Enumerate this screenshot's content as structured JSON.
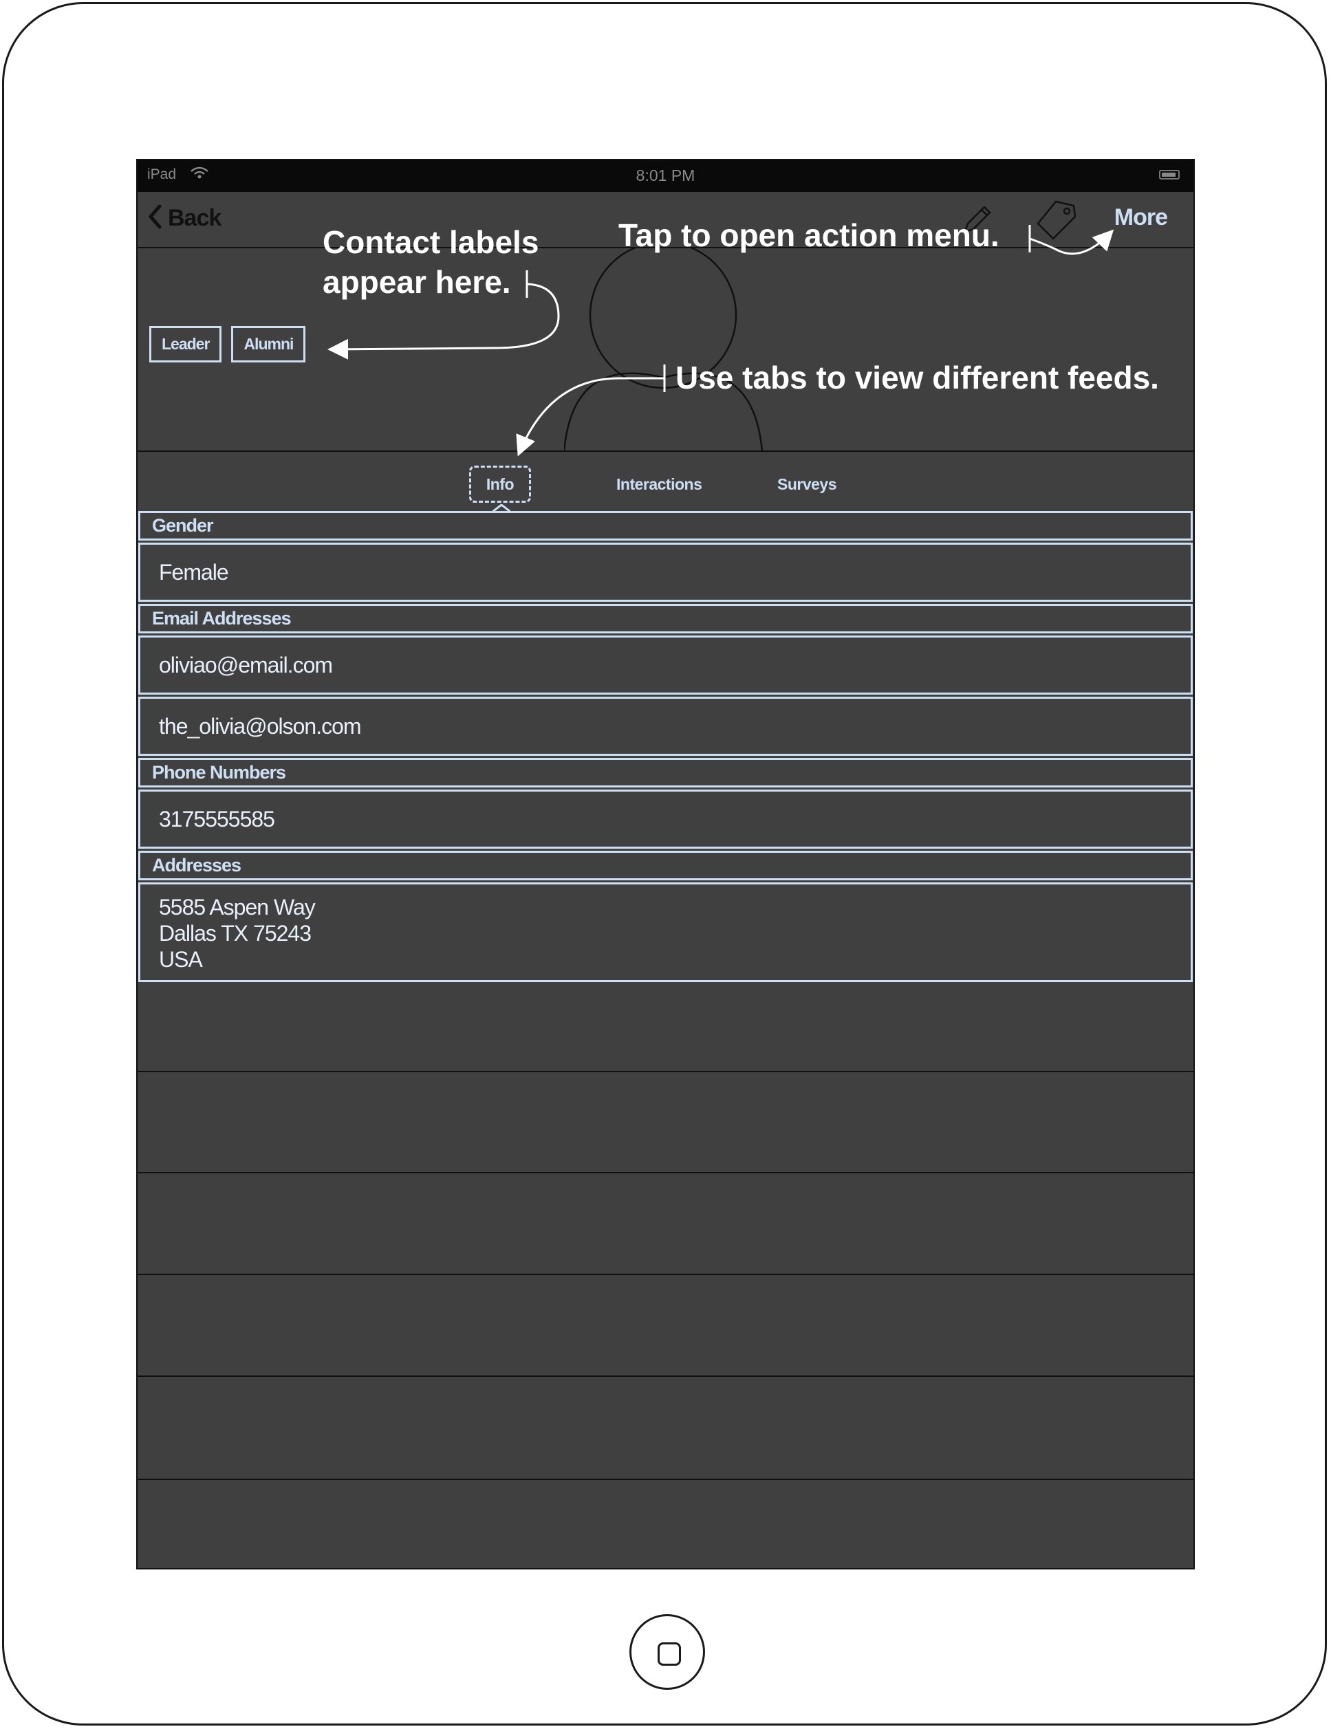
{
  "status_bar": {
    "carrier": "iPad",
    "time": "8:01 PM"
  },
  "nav": {
    "back_label": "Back",
    "more_label": "More"
  },
  "labels": [
    "Leader",
    "Alumni"
  ],
  "tabs": {
    "info": "Info",
    "interactions": "Interactions",
    "surveys": "Surveys"
  },
  "sections": {
    "gender": {
      "header": "Gender",
      "value": "Female"
    },
    "email": {
      "header": "Email Addresses",
      "values": [
        "oliviao@email.com",
        "the_olivia@olson.com"
      ]
    },
    "phone": {
      "header": "Phone Numbers",
      "value": "3175555585"
    },
    "address": {
      "header": "Addresses",
      "line1": "5585 Aspen Way",
      "line2": "Dallas TX 75243",
      "line3": "USA"
    }
  },
  "annotations": {
    "labels_note_1": "Contact labels",
    "labels_note_2": "appear here.",
    "action_note": "Tap to open action menu.",
    "tabs_note": "Use tabs to view different feeds."
  },
  "colors": {
    "screen_bg": "#404040",
    "accent": "#cde0f3",
    "status_bar": "#0a0a0a"
  },
  "icons": [
    "wifi-icon",
    "battery-icon",
    "back-chevron-icon",
    "pencil-icon",
    "tag-icon",
    "avatar-placeholder-icon",
    "home-button-icon"
  ]
}
